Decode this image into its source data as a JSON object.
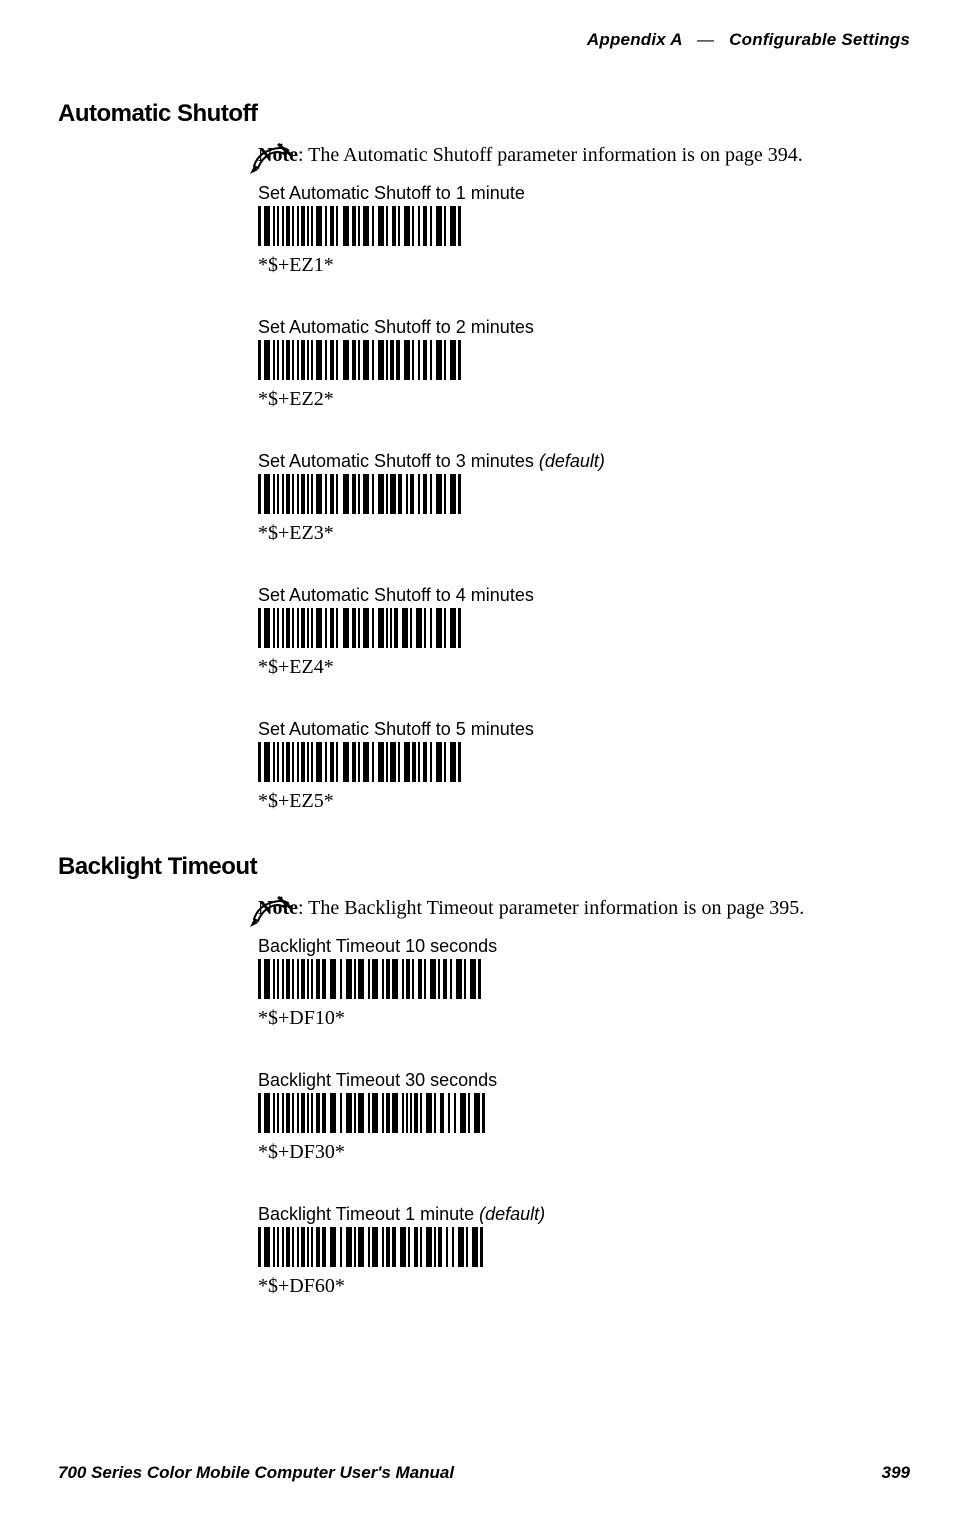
{
  "header": {
    "appendix": "Appendix A",
    "dash": "—",
    "title": "Configurable Settings"
  },
  "sections": {
    "auto_shutoff": {
      "title": "Automatic Shutoff",
      "note_label": "Note",
      "note_text": ": The Automatic Shutoff parameter information is on page 394.",
      "entries": [
        {
          "label": "Set Automatic Shutoff to 1 minute",
          "default": "",
          "code": "*$+EZ1*"
        },
        {
          "label": "Set Automatic Shutoff to 2 minutes",
          "default": "",
          "code": "*$+EZ2*"
        },
        {
          "label": "Set Automatic Shutoff to 3 minutes ",
          "default": "(default)",
          "code": "*$+EZ3*"
        },
        {
          "label": "Set Automatic Shutoff to 4 minutes",
          "default": "",
          "code": "*$+EZ4*"
        },
        {
          "label": "Set Automatic Shutoff to 5 minutes",
          "default": "",
          "code": "*$+EZ5*"
        }
      ]
    },
    "backlight": {
      "title": "Backlight Timeout",
      "note_label": "Note",
      "note_text": ": The Backlight Timeout parameter information is on page 395.",
      "entries": [
        {
          "label": "Backlight Timeout 10 seconds",
          "default": "",
          "code": "*$+DF10*"
        },
        {
          "label": "Backlight Timeout 30 seconds",
          "default": "",
          "code": "*$+DF30*"
        },
        {
          "label": "Backlight Timeout 1 minute ",
          "default": "(default)",
          "code": "*$+DF60*"
        }
      ]
    }
  },
  "footer": {
    "left": "700 Series Color Mobile Computer User's Manual",
    "right": "399"
  }
}
